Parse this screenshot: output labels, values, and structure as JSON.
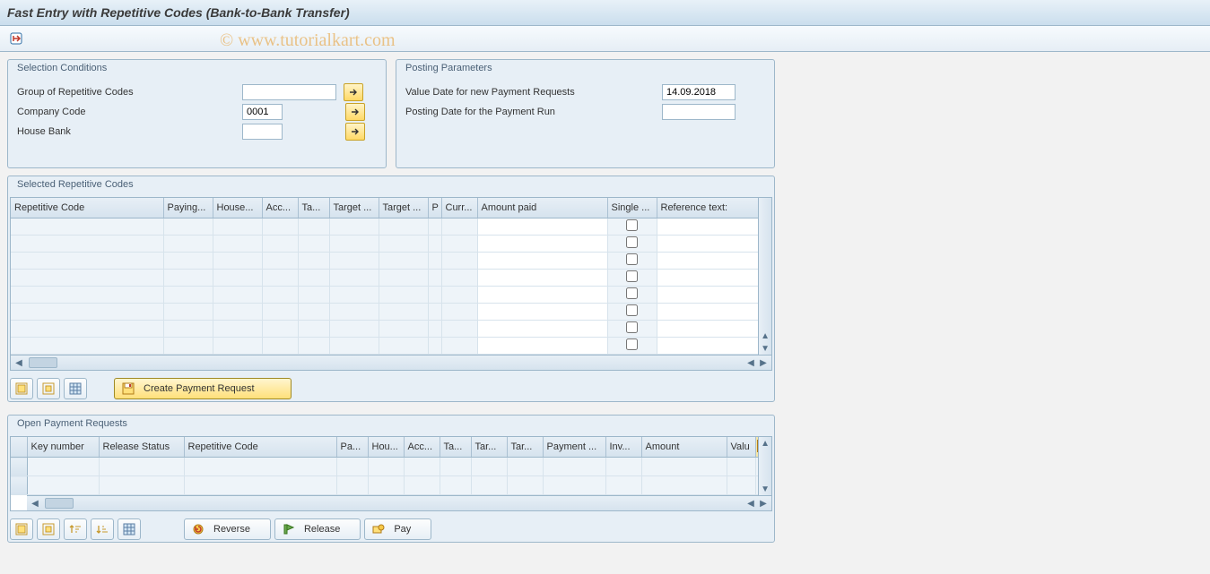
{
  "title": "Fast Entry with Repetitive Codes (Bank-to-Bank Transfer)",
  "watermark": "© www.tutorialkart.com",
  "groups": {
    "selection": {
      "title": "Selection Conditions",
      "fields": {
        "group_label": "Group of Repetitive Codes",
        "group_value": "",
        "company_label": "Company Code",
        "company_value": "0001",
        "house_label": "House Bank",
        "house_value": ""
      }
    },
    "posting": {
      "title": "Posting Parameters",
      "fields": {
        "value_date_label": "Value Date for new Payment Requests",
        "value_date_value": "14.09.2018",
        "posting_date_label": "Posting Date for the Payment Run",
        "posting_date_value": ""
      }
    },
    "selected_codes": {
      "title": "Selected Repetitive Codes",
      "columns": [
        "Repetitive Code",
        "Paying...",
        "House...",
        "Acc...",
        "Ta...",
        "Target ...",
        "Target ...",
        "P",
        "Curr...",
        "Amount paid",
        "Single ...",
        "Reference text:"
      ]
    },
    "open_requests": {
      "title": "Open Payment Requests",
      "columns": [
        "Key number",
        "Release Status",
        "Repetitive Code",
        "Pa...",
        "Hou...",
        "Acc...",
        "Ta...",
        "Tar...",
        "Tar...",
        "Payment ...",
        "Inv...",
        "Amount",
        "Valu"
      ]
    }
  },
  "buttons": {
    "create_payment": "Create Payment Request",
    "reverse": "Reverse",
    "release": "Release",
    "pay": "Pay"
  }
}
